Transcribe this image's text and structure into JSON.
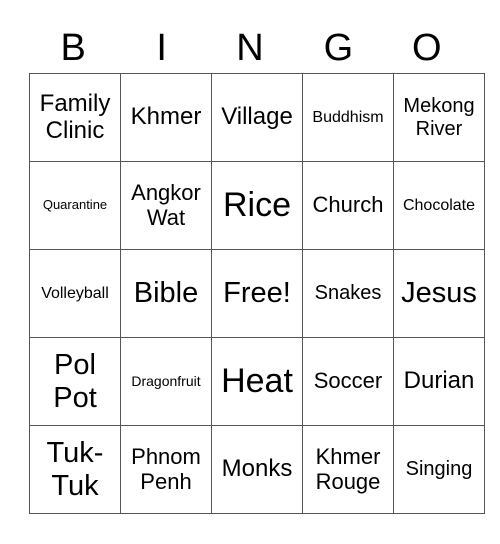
{
  "header": [
    "B",
    "I",
    "N",
    "G",
    "O"
  ],
  "rows": [
    [
      {
        "text": "Family Clinic",
        "size": "s-m"
      },
      {
        "text": "Khmer",
        "size": "s-m"
      },
      {
        "text": "Village",
        "size": "s-m"
      },
      {
        "text": "Buddhism",
        "size": "s-xs"
      },
      {
        "text": "Mekong River",
        "size": "s-s"
      }
    ],
    [
      {
        "text": "Quarantine",
        "size": "s-tiny"
      },
      {
        "text": "Angkor Wat",
        "size": "s-ml"
      },
      {
        "text": "Rice",
        "size": "s-xl"
      },
      {
        "text": "Church",
        "size": "s-ml"
      },
      {
        "text": "Chocolate",
        "size": "s-xs"
      }
    ],
    [
      {
        "text": "Volleyball",
        "size": "s-xs"
      },
      {
        "text": "Bible",
        "size": "s-l"
      },
      {
        "text": "Free!",
        "size": "s-l"
      },
      {
        "text": "Snakes",
        "size": "s-s"
      },
      {
        "text": "Jesus",
        "size": "s-l"
      }
    ],
    [
      {
        "text": "Pol Pot",
        "size": "s-l"
      },
      {
        "text": "Dragonfruit",
        "size": "s-xxs"
      },
      {
        "text": "Heat",
        "size": "s-xl"
      },
      {
        "text": "Soccer",
        "size": "s-ml"
      },
      {
        "text": "Durian",
        "size": "s-m"
      }
    ],
    [
      {
        "text": "Tuk-Tuk",
        "size": "s-l"
      },
      {
        "text": "Phnom Penh",
        "size": "s-ml"
      },
      {
        "text": "Monks",
        "size": "s-m"
      },
      {
        "text": "Khmer Rouge",
        "size": "s-ml"
      },
      {
        "text": "Singing",
        "size": "s-s"
      }
    ]
  ]
}
